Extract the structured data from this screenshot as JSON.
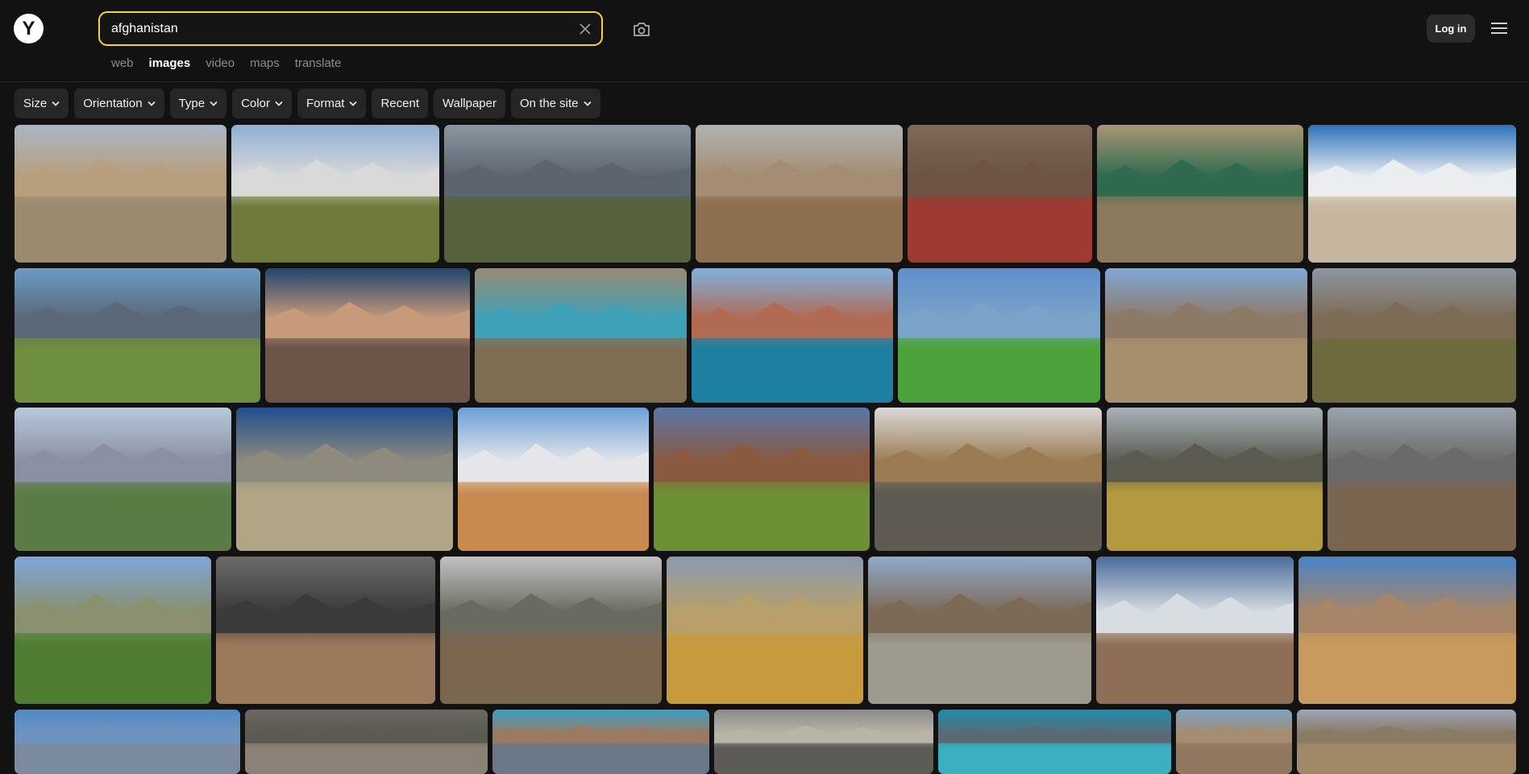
{
  "search": {
    "query": "afghanistan",
    "placeholder": ""
  },
  "logo": {
    "letter": "Y"
  },
  "auth": {
    "login_label": "Log in"
  },
  "tabs": [
    {
      "label": "web",
      "active": false
    },
    {
      "label": "images",
      "active": true
    },
    {
      "label": "video",
      "active": false
    },
    {
      "label": "maps",
      "active": false
    },
    {
      "label": "translate",
      "active": false
    }
  ],
  "filters": [
    {
      "label": "Size",
      "dropdown": true
    },
    {
      "label": "Orientation",
      "dropdown": true
    },
    {
      "label": "Type",
      "dropdown": true
    },
    {
      "label": "Color",
      "dropdown": true
    },
    {
      "label": "Format",
      "dropdown": true
    },
    {
      "label": "Recent",
      "dropdown": false
    },
    {
      "label": "Wallpaper",
      "dropdown": false
    },
    {
      "label": "On the site",
      "dropdown": true
    }
  ],
  "colors": {
    "accent": "#f7d33b",
    "background": "#121212",
    "chip": "#262626"
  },
  "results": [
    {
      "subject": "cliffs-valley",
      "sky": "#a9b6c4",
      "land": "#9a8a6e",
      "ridge": "#b89f7e"
    },
    {
      "subject": "mountain-village",
      "sky": "#8fb0d4",
      "land": "#6f7a3a",
      "ridge": "#d9d9d9"
    },
    {
      "subject": "city-aerial",
      "sky": "#8a96a0",
      "land": "#56623c",
      "ridge": "#5b6570"
    },
    {
      "subject": "hillside-houses",
      "sky": "#b1b3b1",
      "land": "#8e6f4f",
      "ridge": "#a48d72"
    },
    {
      "subject": "children-group",
      "sky": "#7e6a5a",
      "land": "#9e3a30",
      "ridge": "#6d5444"
    },
    {
      "subject": "classroom",
      "sky": "#a99676",
      "land": "#8b7a5c",
      "ridge": "#2f6b4e"
    },
    {
      "subject": "snowy-peak",
      "sky": "#2e72b8",
      "land": "#c8b7a0",
      "ridge": "#ebeef1"
    },
    {
      "subject": "valley-road",
      "sky": "#6c9bc7",
      "land": "#6f8f3e",
      "ridge": "#5a6877"
    },
    {
      "subject": "mosque-night",
      "sky": "#22456f",
      "land": "#6c5448",
      "ridge": "#c79a7a"
    },
    {
      "subject": "blue-mosque",
      "sky": "#9a8a72",
      "land": "#7f6d52",
      "ridge": "#3fa1b8"
    },
    {
      "subject": "blue-lake",
      "sky": "#7fb0df",
      "land": "#1c7fa3",
      "ridge": "#b06b52"
    },
    {
      "subject": "green-hills",
      "sky": "#5f8ecc",
      "land": "#4da23b",
      "ridge": "#7aa3c9"
    },
    {
      "subject": "men-donkey",
      "sky": "#7fa8d6",
      "land": "#a88f6c",
      "ridge": "#8d7a66"
    },
    {
      "subject": "valley-mountains",
      "sky": "#8c96a3",
      "land": "#6d6a3e",
      "ridge": "#7c6b55"
    },
    {
      "subject": "river-valley",
      "sky": "#b8c9dc",
      "land": "#5c7c45",
      "ridge": "#8a8fa3"
    },
    {
      "subject": "rocky-slope",
      "sky": "#1f4f8e",
      "land": "#b0a686",
      "ridge": "#8e8a7e"
    },
    {
      "subject": "orange-cliffs",
      "sky": "#6aa0d8",
      "land": "#c88a4e",
      "ridge": "#e6e6ea"
    },
    {
      "subject": "fields-path",
      "sky": "#5a76a8",
      "land": "#6e8f34",
      "ridge": "#8a5a40"
    },
    {
      "subject": "market-street",
      "sky": "#d9d9d9",
      "land": "#5f5a52",
      "ridge": "#9b7b52"
    },
    {
      "subject": "farmer-portrait",
      "sky": "#a9b2b9",
      "land": "#b39a3e",
      "ridge": "#5a5a4f"
    },
    {
      "subject": "lake-canyon",
      "sky": "#9aa4ad",
      "land": "#7a6450",
      "ridge": "#6b6a6a"
    },
    {
      "subject": "green-valley",
      "sky": "#7ea7d9",
      "land": "#4f7d32",
      "ridge": "#8a9070"
    },
    {
      "subject": "desert-ridges",
      "sky": "#6d6a67",
      "land": "#9a7a5a",
      "ridge": "#3b3a38"
    },
    {
      "subject": "stone-village",
      "sky": "#c1c3c2",
      "land": "#7b6650",
      "ridge": "#6c6a60"
    },
    {
      "subject": "golden-hills",
      "sky": "#8a9ab0",
      "land": "#c89a3e",
      "ridge": "#b7a06b"
    },
    {
      "subject": "soldiers",
      "sky": "#8fa9c9",
      "land": "#9e9a8e",
      "ridge": "#7c6a56"
    },
    {
      "subject": "snowy-cliffs",
      "sky": "#4a6c9c",
      "land": "#8e6f55",
      "ridge": "#d8dde2"
    },
    {
      "subject": "children-sitting",
      "sky": "#4a84c4",
      "land": "#c99a5e",
      "ridge": "#a8866a"
    },
    {
      "subject": "blue-sky-ridge",
      "sky": "#4f8ac5",
      "land": "#7c8aa0",
      "ridge": "#6f93c0"
    },
    {
      "subject": "rock-face",
      "sky": "#6b6660",
      "land": "#8a8276",
      "ridge": "#5c5852"
    },
    {
      "subject": "cliff-lake",
      "sky": "#3aa0c8",
      "land": "#6a7888",
      "ridge": "#9a7a62"
    },
    {
      "subject": "town-hillside",
      "sky": "#8a8a8a",
      "land": "#5e5a56",
      "ridge": "#b9b4a8"
    },
    {
      "subject": "turquoise-lake",
      "sky": "#1f8eb0",
      "land": "#3bb0c0",
      "ridge": "#5a6a74"
    },
    {
      "subject": "gorge",
      "sky": "#7da3c6",
      "land": "#907860",
      "ridge": "#a58c70"
    },
    {
      "subject": "plain-mountains",
      "sky": "#9aa8b8",
      "land": "#a08868",
      "ridge": "#8a7a66"
    }
  ]
}
